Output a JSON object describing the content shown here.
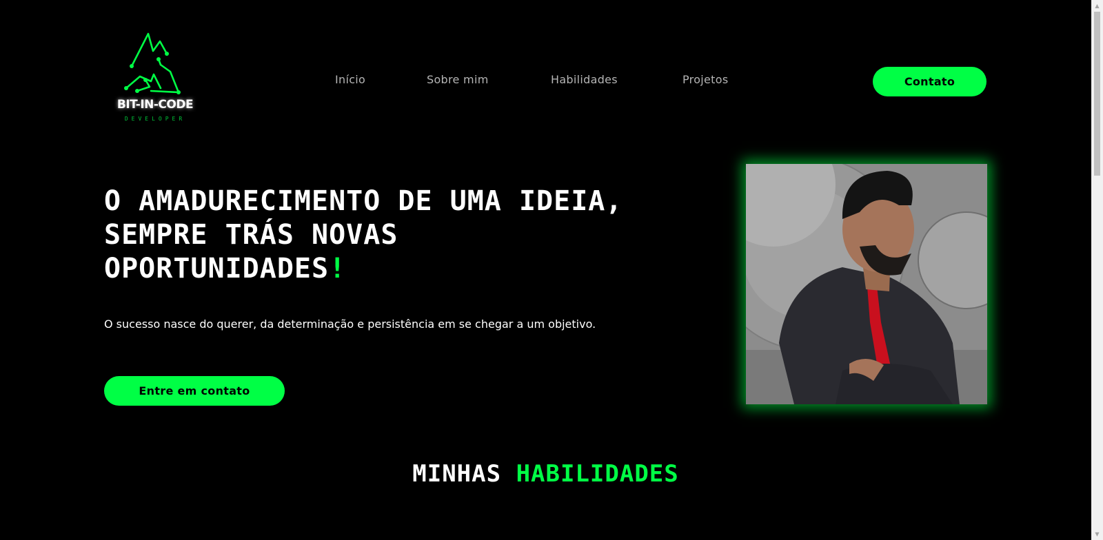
{
  "brand": {
    "name": "BIT-IN-CODE",
    "tagline": "DEVELOPER",
    "accent_color": "#00ff45"
  },
  "nav": {
    "items": [
      {
        "label": "Início"
      },
      {
        "label": "Sobre mim"
      },
      {
        "label": "Habilidades"
      },
      {
        "label": "Projetos"
      }
    ],
    "contact_label": "Contato"
  },
  "hero": {
    "title_line1": "O AMADURECIMENTO DE UMA IDEIA,",
    "title_line2": "SEMPRE TRÁS NOVAS",
    "title_line3": "OPORTUNIDADES",
    "title_punct": "!",
    "subtitle": "O sucesso nasce do querer, da determinação e persistência em se chegar a um objetivo.",
    "cta_label": "Entre em contato"
  },
  "photo": {
    "subject": "profile-photo",
    "border_glow_color": "#00ff45"
  },
  "skills": {
    "heading_white": "MINHAS",
    "heading_green": "HABILIDADES"
  },
  "icons": {
    "logo": "circuit-triangle-logo",
    "scroll_up": "up-arrow-icon",
    "scroll_down": "down-arrow-icon"
  }
}
